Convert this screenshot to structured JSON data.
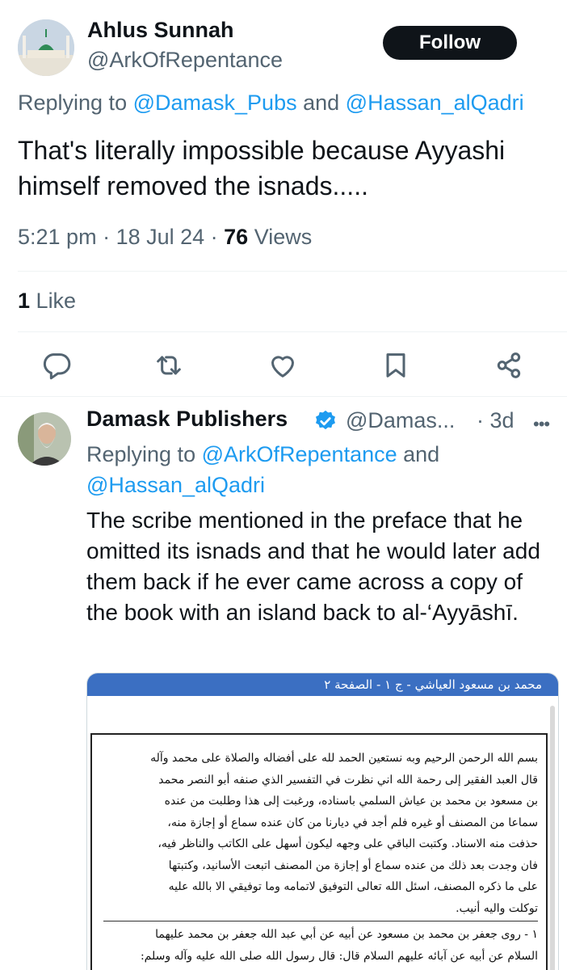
{
  "main_tweet": {
    "author_name": "Ahlus Sunnah",
    "author_handle": "@ArkOfRepentance",
    "follow_label": "Follow",
    "replying_prefix": "Replying to ",
    "replying_to_1": "@Damask_Pubs",
    "replying_and": " and ",
    "replying_to_2": "@Hassan_alQadri",
    "text": "That's literally impossible because Ayyashi himself removed the isnads.....",
    "time": "5:21 pm",
    "date": "18 Jul 24",
    "views_count": "76",
    "views_label": "Views",
    "likes_count": "1",
    "likes_label": "Like",
    "actions": [
      "reply-icon",
      "repost-icon",
      "like-icon",
      "bookmark-icon",
      "share-icon"
    ]
  },
  "reply_tweet": {
    "author_name": "Damask Publishers",
    "author_handle": "@Damas...",
    "time": "3d",
    "replying_prefix": "Replying to ",
    "replying_to_1": "@ArkOfRepentance",
    "replying_and": " and ",
    "replying_to_2": "@Hassan_alQadri",
    "text": "The scribe mentioned in the preface that he omitted its isnads and that he would later add them back if he ever came across a copy of the book with an island back to al-‘Ayyāshī.",
    "verified_color": "#1d9bf0",
    "document": {
      "header": "محمد بن مسعود العياشي - ج ١ - الصفحة ٢",
      "lines": [
        "بسم الله الرحمن الرحيم وبه نستعين الحمد لله على أفضاله والصلاة على محمد وآله",
        "قال العبد الفقير إلى رحمة الله اني نظرت في التفسير الذي صنفه أبو النصر محمد",
        "بن مسعود بن محمد بن عياش السلمي باسناده، ورغبت إلى هذا وطلبت من عنده",
        "سماعا من المصنف أو غيره فلم أجد في ديارنا من كان عنده سماع أو إجازة منه،",
        "حذفت منه الاسناد. وكتبت الباقي على وجهه ليكون أسهل على الكاتب والناظر فيه،",
        "فان وجدت بعد ذلك من عنده سماع أو إجازة من المصنف اتبعت الأسانيد، وكتبتها",
        "على ما ذكره المصنف، اسئل الله تعالى التوفيق لاتمامه وما توفيقي الا بالله عليه",
        "توكلت واليه أنيب."
      ],
      "lines_after_rule": [
        "١ - روى جعفر بن محمد بن مسعود عن أبيه عن أبي عبد الله جعفر بن محمد عليهما",
        "السلام عن أبيه عن آبائه عليهم السلام قال: قال رسول الله صلى الله عليه وآله وسلم:"
      ]
    }
  },
  "colors": {
    "accent": "#1d9bf0",
    "text": "#0f1419",
    "secondary": "#536471",
    "doc_header": "#3b6fc2"
  }
}
